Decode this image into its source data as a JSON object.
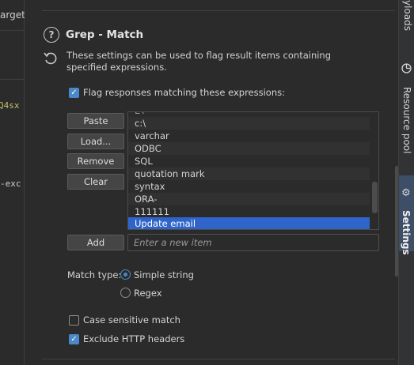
{
  "left_panel": {
    "tab_partial": "arget",
    "code_lines": [
      "Q4sx",
      "-exc"
    ]
  },
  "section": {
    "help_glyph": "?",
    "title": "Grep - Match",
    "description": "These settings can be used to flag result items containing specified expressions."
  },
  "flag_checkbox": {
    "label": "Flag responses matching these expressions:",
    "checked": true
  },
  "buttons": {
    "paste": "Paste",
    "load": "Load...",
    "remove": "Remove",
    "clear": "Clear",
    "add": "Add"
  },
  "list": {
    "items": [
      "ÉÝ",
      "c:\\",
      "varchar",
      "ODBC",
      "SQL",
      "quotation mark",
      "syntax",
      "ORA-",
      "111111",
      "Update email"
    ],
    "selected": "Update email"
  },
  "new_item": {
    "placeholder": "Enter a new item"
  },
  "match_type": {
    "label": "Match type:",
    "options": [
      "Simple string",
      "Regex"
    ],
    "selected": "Simple string"
  },
  "case_sensitive": {
    "label": "Case sensitive match",
    "checked": false
  },
  "exclude_headers": {
    "label": "Exclude HTTP headers",
    "checked": true
  },
  "right_sidebar": {
    "tabs": [
      {
        "label": "Payloads",
        "icon": "payloads-icon"
      },
      {
        "label": "Resource pool",
        "icon": "resource-pool-icon"
      },
      {
        "label": "Settings",
        "icon": "gear-icon"
      }
    ],
    "selected": "Settings"
  },
  "colors": {
    "accent": "#4a88c7",
    "selected_row": "#2f65ca",
    "background": "#2b2b2b"
  }
}
